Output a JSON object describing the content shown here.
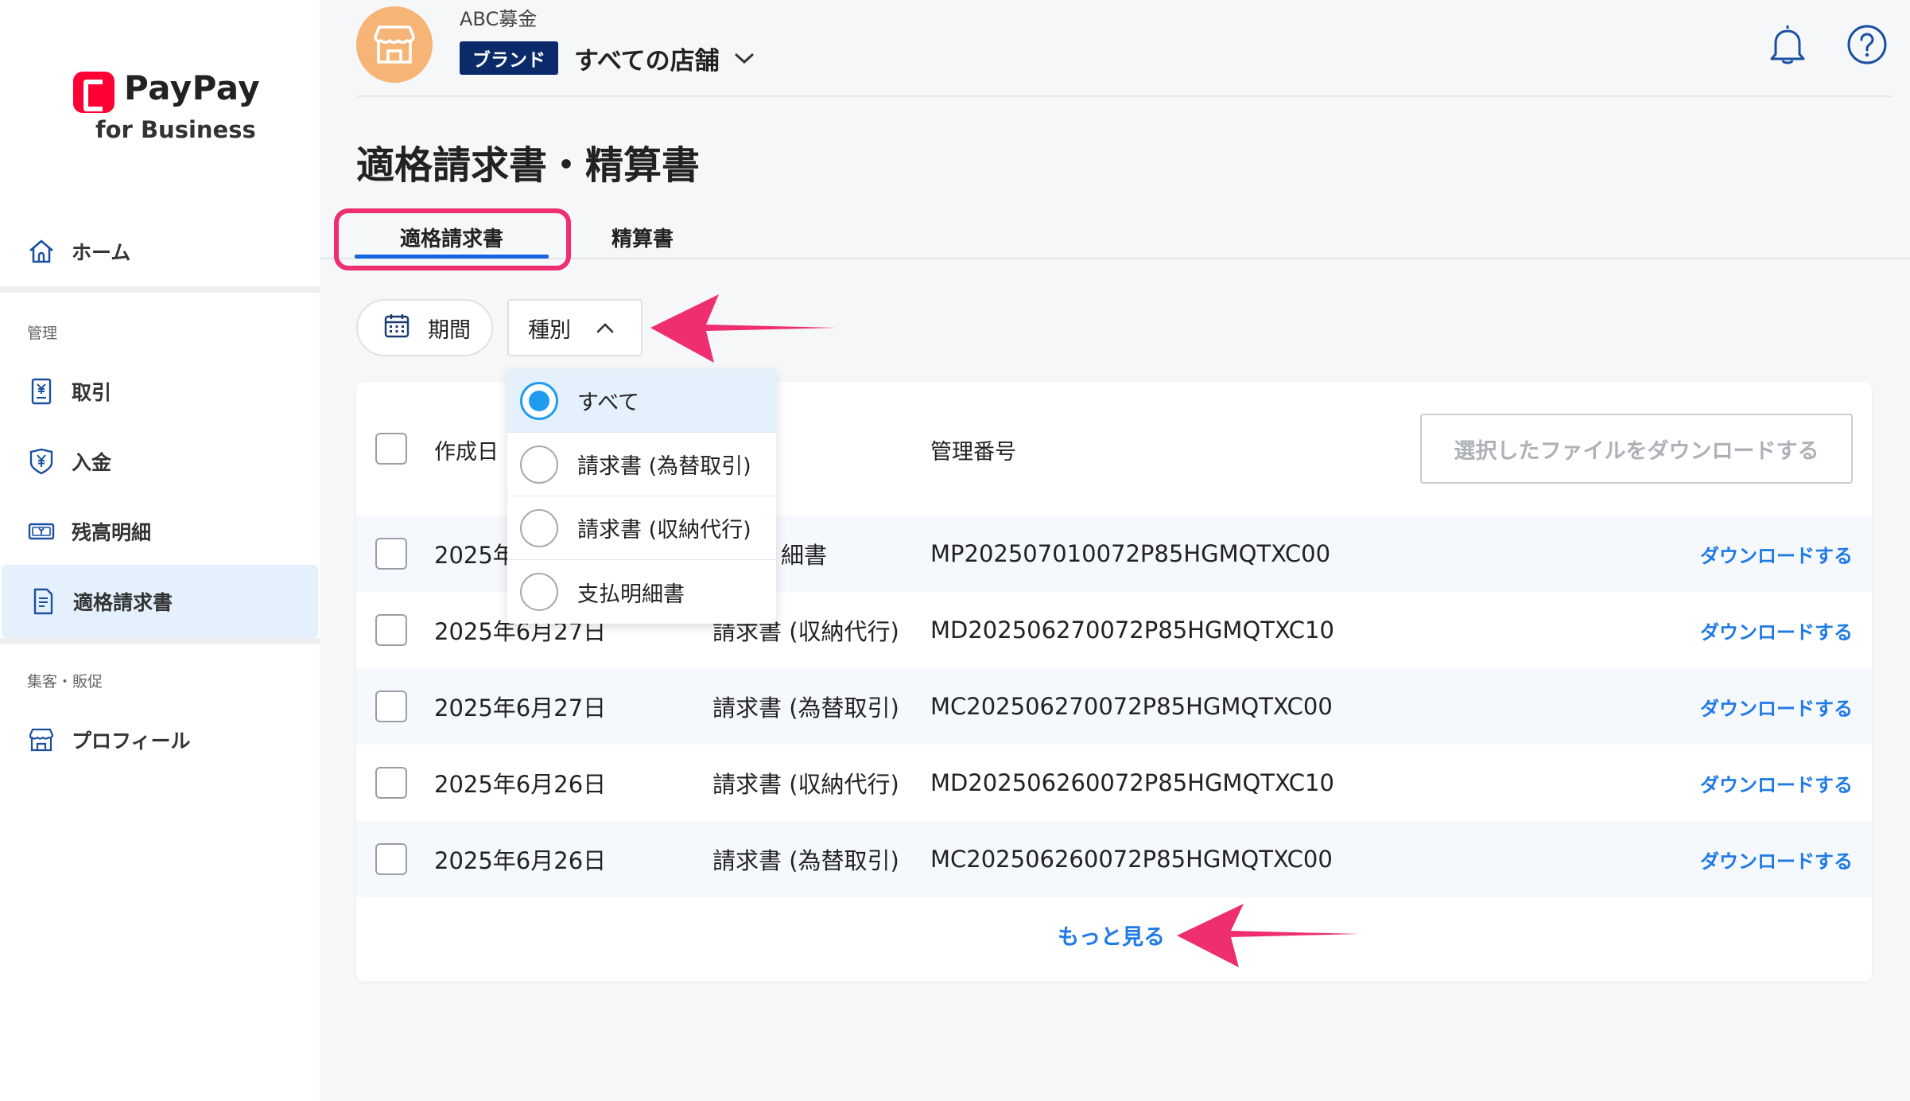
{
  "brand": {
    "logo_word": "PayPay",
    "logo_sub": "for Business"
  },
  "sidebar": {
    "home": "ホーム",
    "section_manage": "管理",
    "items": [
      {
        "label": "取引",
        "icon": "receipt-icon"
      },
      {
        "label": "入金",
        "icon": "yen-shield-icon"
      },
      {
        "label": "残高明細",
        "icon": "cash-icon"
      },
      {
        "label": "適格請求書",
        "icon": "document-icon",
        "active": true
      }
    ],
    "section_promo": "集客・販促",
    "profile": "プロフィール"
  },
  "header": {
    "org_name": "ABC募金",
    "brand_badge": "ブランド",
    "store_select": "すべての店舗"
  },
  "page": {
    "title": "適格請求書・精算書",
    "tabs": [
      "適格請求書",
      "精算書"
    ],
    "active_tab": 0
  },
  "filters": {
    "period": "期間",
    "type": "種別",
    "type_options": [
      "すべて",
      "請求書 (為替取引)",
      "請求書 (収納代行)",
      "支払明細書"
    ],
    "type_selected": 0
  },
  "table": {
    "headers": {
      "date": "作成日",
      "type": "",
      "number": "管理番号"
    },
    "download_selected": "選択したファイルをダウンロードする",
    "rows": [
      {
        "date": "2025年",
        "type": "細書",
        "number": "MP202507010072P85HGMQTXC00",
        "action": "ダウンロードする"
      },
      {
        "date": "2025年6月27日",
        "type": "請求書 (収納代行)",
        "number": "MD202506270072P85HGMQTXC10",
        "action": "ダウンロードする"
      },
      {
        "date": "2025年6月27日",
        "type": "請求書 (為替取引)",
        "number": "MC202506270072P85HGMQTXC00",
        "action": "ダウンロードする"
      },
      {
        "date": "2025年6月26日",
        "type": "請求書 (収納代行)",
        "number": "MD202506260072P85HGMQTXC10",
        "action": "ダウンロードする"
      },
      {
        "date": "2025年6月26日",
        "type": "請求書 (為替取引)",
        "number": "MC202506260072P85HGMQTXC00",
        "action": "ダウンロードする"
      }
    ],
    "more": "もっと見る"
  },
  "colors": {
    "accent": "#1f7ae6",
    "annotation": "#ee2e6e",
    "brand_badge": "#0b2a6a",
    "active_nav": "#e4f1fd"
  }
}
